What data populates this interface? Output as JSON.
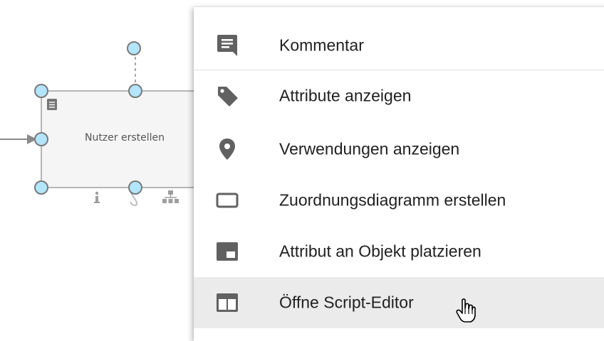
{
  "diagram": {
    "shape_label": "Nutzer erstellen"
  },
  "context_menu": {
    "items": [
      {
        "label": "Kommentar",
        "icon": "comment-icon"
      },
      {
        "label": "Attribute anzeigen",
        "icon": "tag-icon"
      },
      {
        "label": "Verwendungen anzeigen",
        "icon": "map-pin-icon"
      },
      {
        "label": "Zuordnungsdiagramm erstellen",
        "icon": "rectangle-outline-icon"
      },
      {
        "label": "Attribut an Objekt platzieren",
        "icon": "attribute-placement-icon"
      },
      {
        "label": "Öffne Script-Editor",
        "icon": "script-editor-icon"
      }
    ],
    "hovered_item": "Öffne Script-Editor"
  },
  "colors": {
    "icon": "#616161",
    "handle_fill": "#b3e5fc",
    "handle_stroke": "#7a7a7a",
    "hover_bg": "#ebebeb"
  }
}
